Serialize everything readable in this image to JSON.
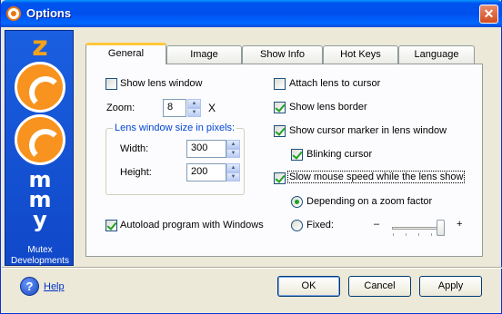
{
  "window": {
    "title": "Options",
    "close_glyph": "✕"
  },
  "logo": {
    "brand": "zoommy",
    "letters": [
      "z",
      "m",
      "m",
      "y"
    ],
    "company_line1": "Mutex",
    "company_line2": "Developments"
  },
  "tabs": [
    {
      "label": "General",
      "active": true
    },
    {
      "label": "Image",
      "active": false
    },
    {
      "label": "Show Info",
      "active": false
    },
    {
      "label": "Hot Keys",
      "active": false
    },
    {
      "label": "Language",
      "active": false
    }
  ],
  "general": {
    "show_lens_window": {
      "label": "Show lens window",
      "checked": false
    },
    "zoom": {
      "label": "Zoom:",
      "value": "8",
      "suffix": "X"
    },
    "lens_size_group": {
      "label": "Lens window size in pixels:",
      "width_label": "Width:",
      "width_value": "300",
      "height_label": "Height:",
      "height_value": "200"
    },
    "autoload": {
      "label": "Autoload program with Windows",
      "checked": true
    },
    "attach_lens": {
      "label": "Attach lens to cursor",
      "checked": false
    },
    "show_lens_border": {
      "label": "Show lens border",
      "checked": true
    },
    "show_cursor_marker": {
      "label": "Show cursor marker in lens window",
      "checked": true
    },
    "blinking_cursor": {
      "label": "Blinking cursor",
      "checked": true
    },
    "slow_mouse": {
      "label": "Slow mouse speed while the lens show",
      "checked": true
    },
    "depending_zoom": {
      "label": "Depending on a zoom factor",
      "selected": true
    },
    "fixed": {
      "label": "Fixed:",
      "selected": false
    },
    "slider": {
      "minus": "–",
      "plus": "+",
      "level": 0.85
    }
  },
  "buttons": {
    "ok": "OK",
    "cancel": "Cancel",
    "apply": "Apply",
    "help": "Help",
    "help_glyph": "?"
  },
  "icons": {
    "app": "zoommy-app-icon",
    "close": "close-icon",
    "help": "help-question-icon",
    "spin_up": "▲",
    "spin_down": "▼"
  },
  "colors": {
    "titlebar": "#0053ee",
    "logo_panel": "#1a5fe0",
    "logo_orange": "#f7931e",
    "group_label": "#0046d5",
    "check_green": "#21a121",
    "tab_highlight": "#ffc83c"
  }
}
